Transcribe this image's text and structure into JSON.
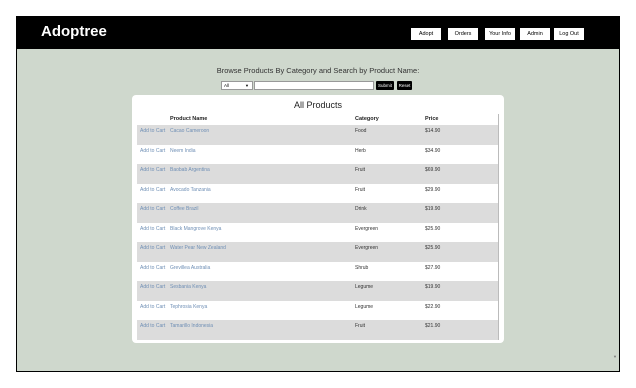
{
  "app": {
    "brand": "Adoptree"
  },
  "nav": [
    {
      "label": "Adopt"
    },
    {
      "label": "Orders"
    },
    {
      "label": "Your Info"
    },
    {
      "label": "Admin"
    },
    {
      "label": "Log Out"
    }
  ],
  "browse": {
    "title": "Browse Products By Category and Search by Product Name:",
    "category_selected": "All",
    "search_value": "",
    "submit_label": "Submit",
    "reset_label": "Reset"
  },
  "products": {
    "title": "All Products",
    "headers": {
      "action": "",
      "name": "Product Name",
      "category": "Category",
      "price": "Price"
    },
    "rows": [
      {
        "action": "Add to Cart",
        "name": "Cacao Cameroon",
        "category": "Food",
        "price": "$14.90"
      },
      {
        "action": "Add to Cart",
        "name": "Neem India",
        "category": "Herb",
        "price": "$34.90"
      },
      {
        "action": "Add to Cart",
        "name": "Baobab Argentina",
        "category": "Fruit",
        "price": "$69.90"
      },
      {
        "action": "Add to Cart",
        "name": "Avocado Tanzania",
        "category": "Fruit",
        "price": "$29.90"
      },
      {
        "action": "Add to Cart",
        "name": "Coffee Brazil",
        "category": "Drink",
        "price": "$19.90"
      },
      {
        "action": "Add to Cart",
        "name": "Black Mangrove Kenya",
        "category": "Evergreen",
        "price": "$25.90"
      },
      {
        "action": "Add to Cart",
        "name": "Water Pear New Zealand",
        "category": "Evergreen",
        "price": "$25.90"
      },
      {
        "action": "Add to Cart",
        "name": "Grevillea Australia",
        "category": "Shrub",
        "price": "$27.90"
      },
      {
        "action": "Add to Cart",
        "name": "Sesbania Kenya",
        "category": "Legume",
        "price": "$19.90"
      },
      {
        "action": "Add to Cart",
        "name": "Tephrosia Kenya",
        "category": "Legume",
        "price": "$22.90"
      },
      {
        "action": "Add to Cart",
        "name": "Tamarillo Indonesia",
        "category": "Fruit",
        "price": "$21.90"
      }
    ]
  }
}
